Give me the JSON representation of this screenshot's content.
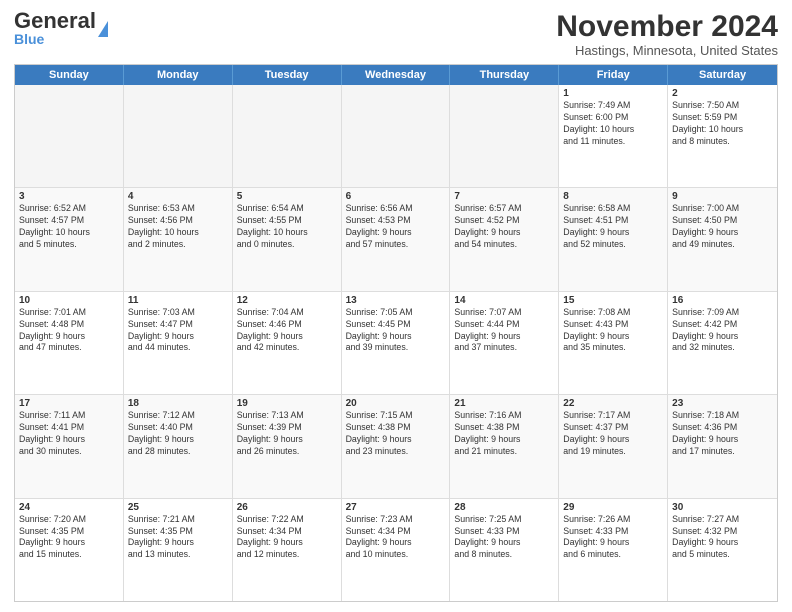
{
  "header": {
    "logo_general": "General",
    "logo_blue": "Blue",
    "month_title": "November 2024",
    "location": "Hastings, Minnesota, United States"
  },
  "days_of_week": [
    "Sunday",
    "Monday",
    "Tuesday",
    "Wednesday",
    "Thursday",
    "Friday",
    "Saturday"
  ],
  "weeks": [
    [
      {
        "day": "",
        "info": "",
        "empty": true
      },
      {
        "day": "",
        "info": "",
        "empty": true
      },
      {
        "day": "",
        "info": "",
        "empty": true
      },
      {
        "day": "",
        "info": "",
        "empty": true
      },
      {
        "day": "",
        "info": "",
        "empty": true
      },
      {
        "day": "1",
        "info": "Sunrise: 7:49 AM\nSunset: 6:00 PM\nDaylight: 10 hours\nand 11 minutes."
      },
      {
        "day": "2",
        "info": "Sunrise: 7:50 AM\nSunset: 5:59 PM\nDaylight: 10 hours\nand 8 minutes."
      }
    ],
    [
      {
        "day": "3",
        "info": "Sunrise: 6:52 AM\nSunset: 4:57 PM\nDaylight: 10 hours\nand 5 minutes."
      },
      {
        "day": "4",
        "info": "Sunrise: 6:53 AM\nSunset: 4:56 PM\nDaylight: 10 hours\nand 2 minutes."
      },
      {
        "day": "5",
        "info": "Sunrise: 6:54 AM\nSunset: 4:55 PM\nDaylight: 10 hours\nand 0 minutes."
      },
      {
        "day": "6",
        "info": "Sunrise: 6:56 AM\nSunset: 4:53 PM\nDaylight: 9 hours\nand 57 minutes."
      },
      {
        "day": "7",
        "info": "Sunrise: 6:57 AM\nSunset: 4:52 PM\nDaylight: 9 hours\nand 54 minutes."
      },
      {
        "day": "8",
        "info": "Sunrise: 6:58 AM\nSunset: 4:51 PM\nDaylight: 9 hours\nand 52 minutes."
      },
      {
        "day": "9",
        "info": "Sunrise: 7:00 AM\nSunset: 4:50 PM\nDaylight: 9 hours\nand 49 minutes."
      }
    ],
    [
      {
        "day": "10",
        "info": "Sunrise: 7:01 AM\nSunset: 4:48 PM\nDaylight: 9 hours\nand 47 minutes."
      },
      {
        "day": "11",
        "info": "Sunrise: 7:03 AM\nSunset: 4:47 PM\nDaylight: 9 hours\nand 44 minutes."
      },
      {
        "day": "12",
        "info": "Sunrise: 7:04 AM\nSunset: 4:46 PM\nDaylight: 9 hours\nand 42 minutes."
      },
      {
        "day": "13",
        "info": "Sunrise: 7:05 AM\nSunset: 4:45 PM\nDaylight: 9 hours\nand 39 minutes."
      },
      {
        "day": "14",
        "info": "Sunrise: 7:07 AM\nSunset: 4:44 PM\nDaylight: 9 hours\nand 37 minutes."
      },
      {
        "day": "15",
        "info": "Sunrise: 7:08 AM\nSunset: 4:43 PM\nDaylight: 9 hours\nand 35 minutes."
      },
      {
        "day": "16",
        "info": "Sunrise: 7:09 AM\nSunset: 4:42 PM\nDaylight: 9 hours\nand 32 minutes."
      }
    ],
    [
      {
        "day": "17",
        "info": "Sunrise: 7:11 AM\nSunset: 4:41 PM\nDaylight: 9 hours\nand 30 minutes."
      },
      {
        "day": "18",
        "info": "Sunrise: 7:12 AM\nSunset: 4:40 PM\nDaylight: 9 hours\nand 28 minutes."
      },
      {
        "day": "19",
        "info": "Sunrise: 7:13 AM\nSunset: 4:39 PM\nDaylight: 9 hours\nand 26 minutes."
      },
      {
        "day": "20",
        "info": "Sunrise: 7:15 AM\nSunset: 4:38 PM\nDaylight: 9 hours\nand 23 minutes."
      },
      {
        "day": "21",
        "info": "Sunrise: 7:16 AM\nSunset: 4:38 PM\nDaylight: 9 hours\nand 21 minutes."
      },
      {
        "day": "22",
        "info": "Sunrise: 7:17 AM\nSunset: 4:37 PM\nDaylight: 9 hours\nand 19 minutes."
      },
      {
        "day": "23",
        "info": "Sunrise: 7:18 AM\nSunset: 4:36 PM\nDaylight: 9 hours\nand 17 minutes."
      }
    ],
    [
      {
        "day": "24",
        "info": "Sunrise: 7:20 AM\nSunset: 4:35 PM\nDaylight: 9 hours\nand 15 minutes."
      },
      {
        "day": "25",
        "info": "Sunrise: 7:21 AM\nSunset: 4:35 PM\nDaylight: 9 hours\nand 13 minutes."
      },
      {
        "day": "26",
        "info": "Sunrise: 7:22 AM\nSunset: 4:34 PM\nDaylight: 9 hours\nand 12 minutes."
      },
      {
        "day": "27",
        "info": "Sunrise: 7:23 AM\nSunset: 4:34 PM\nDaylight: 9 hours\nand 10 minutes."
      },
      {
        "day": "28",
        "info": "Sunrise: 7:25 AM\nSunset: 4:33 PM\nDaylight: 9 hours\nand 8 minutes."
      },
      {
        "day": "29",
        "info": "Sunrise: 7:26 AM\nSunset: 4:33 PM\nDaylight: 9 hours\nand 6 minutes."
      },
      {
        "day": "30",
        "info": "Sunrise: 7:27 AM\nSunset: 4:32 PM\nDaylight: 9 hours\nand 5 minutes."
      }
    ]
  ]
}
